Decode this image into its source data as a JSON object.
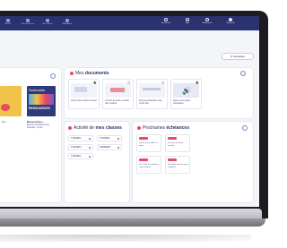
{
  "nav": {
    "items": [
      {
        "label": "Accueil"
      },
      {
        "label": "Mes ressources"
      },
      {
        "label": "Mes classes"
      },
      {
        "label": "Bibliothèque"
      }
    ],
    "right": [
      {
        "label": "Rechercher",
        "icon": "search-icon"
      },
      {
        "label": "Aide",
        "icon": "help-icon"
      },
      {
        "label": "Notifications",
        "icon": "bell-icon"
      },
      {
        "label": "Mon profil",
        "icon": "user-icon"
      }
    ]
  },
  "refresh_label": "↻ Actualiser",
  "books": {
    "sommaire_label": "Sommaire",
    "ressources_label": "RESSOURCES",
    "caption_left_1": "...ire -",
    "caption_right_1": "Ressources...",
    "caption_right_2": "Manuel numérique libre",
    "caption_right_3": "Français - Lycée"
  },
  "documents": {
    "title_prefix": "Mes ",
    "title_bold": "documents",
    "cards": [
      {
        "text": "Lorem ipsum dolor sit amet"
      },
      {
        "text": "Ut enim ad minim veniam, quis nostrud"
      },
      {
        "text": "Sed ut perspiciatis unde omnis iste"
      },
      {
        "text": "Nemo enim ipsam voluptatem"
      }
    ]
  },
  "classes": {
    "title_prefix": "Activité de ",
    "title_bold": "mes classes",
    "rows": [
      {
        "label": "TSASEP1"
      },
      {
        "label": "TSASEP1"
      },
      {
        "label": "TSASEP1"
      },
      {
        "label": "PSMSEP1"
      },
      {
        "label": "TSASEP1"
      }
    ]
  },
  "deadlines": {
    "title_prefix": "Prochaines ",
    "title_bold": "échéances",
    "cards": [
      {
        "text": "Lorem ipsum dolor sit amet"
      },
      {
        "text": "Ut enim ad minim veniam"
      },
      {
        "text": "Duis aute irure dolor in reprehenderit"
      },
      {
        "text": "Excepteur sint occaecat cupidatat"
      }
    ]
  },
  "colors": {
    "nav": "#2a3370",
    "accent": "#e84a5f",
    "panel": "#ffffff",
    "background": "#f4f5f9"
  }
}
